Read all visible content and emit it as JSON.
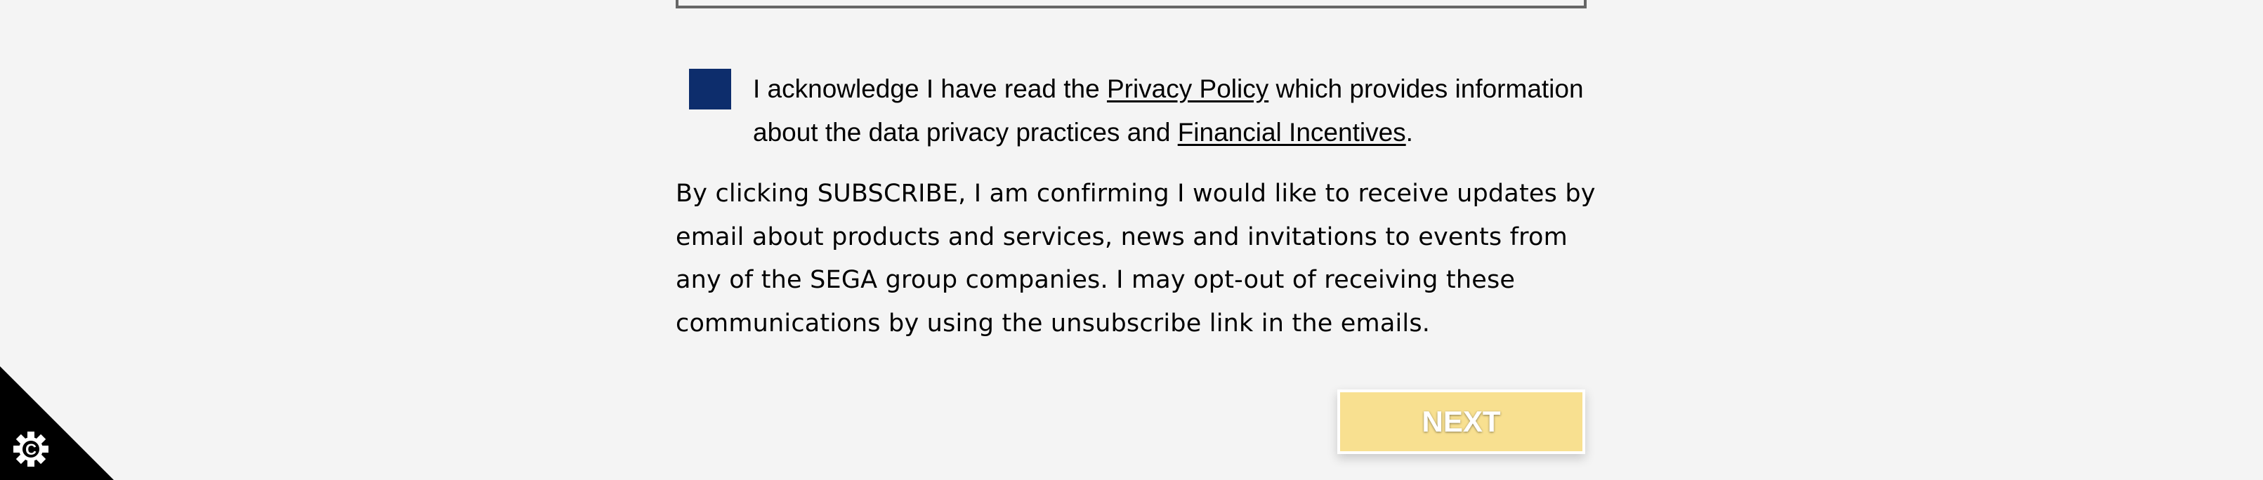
{
  "acknowledgement": {
    "text_before": "I acknowledge I have read the ",
    "privacy_link": "Privacy Policy",
    "text_middle": " which provides information about the data privacy practices and ",
    "incentives_link": "Financial Incentives",
    "text_after": "."
  },
  "consent": {
    "text": "By clicking SUBSCRIBE, I am confirming I would like to receive updates by email about products and services, news and invitations to events from any of the SEGA group companies. I may opt-out of receiving these communications by using the unsubscribe link in the emails."
  },
  "actions": {
    "next_label": "NEXT"
  },
  "cookie_widget": {
    "icon": "cookie-settings-gear-icon",
    "letter": "C"
  },
  "colors": {
    "background": "#f4f4f4",
    "checkbox": "#0d2d6c",
    "next_button": "#f8e090",
    "corner": "#000000"
  }
}
